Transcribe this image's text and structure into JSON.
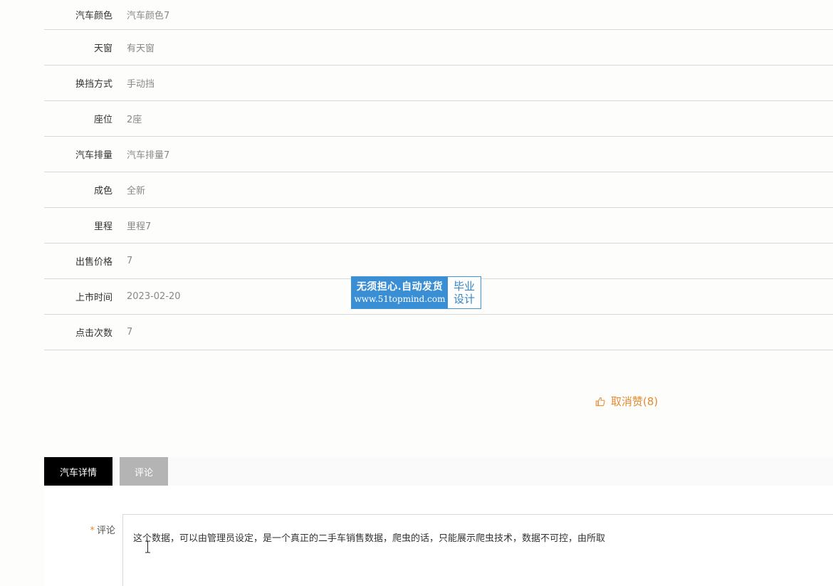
{
  "details": [
    {
      "label": "汽车颜色",
      "value": "汽车颜色7"
    },
    {
      "label": "天窗",
      "value": "有天窗"
    },
    {
      "label": "换挡方式",
      "value": "手动挡"
    },
    {
      "label": "座位",
      "value": "2座"
    },
    {
      "label": "汽车排量",
      "value": "汽车排量7"
    },
    {
      "label": "成色",
      "value": "全新"
    },
    {
      "label": "里程",
      "value": "里程7"
    },
    {
      "label": "出售价格",
      "value": "7"
    },
    {
      "label": "上市时间",
      "value": "2023-02-20"
    },
    {
      "label": "点击次数",
      "value": "7"
    }
  ],
  "watermark": {
    "line1": "无须担心.自动发货",
    "line2": "www.51topmind.com",
    "side_top": "毕业",
    "side_bottom": "设计"
  },
  "like": {
    "icon": "thumbs-up-icon",
    "label": "取消赞(8)",
    "color": "#e48a2f"
  },
  "tabs": [
    {
      "label": "汽车详情",
      "active": true
    },
    {
      "label": "评论",
      "active": false
    }
  ],
  "comment": {
    "required_mark": "*",
    "label": "评论",
    "value": "这个数据，可以由管理员设定，是一个真正的二手车销售数据，爬虫的话，只能展示爬虫技术，数据不可控，由所取"
  }
}
